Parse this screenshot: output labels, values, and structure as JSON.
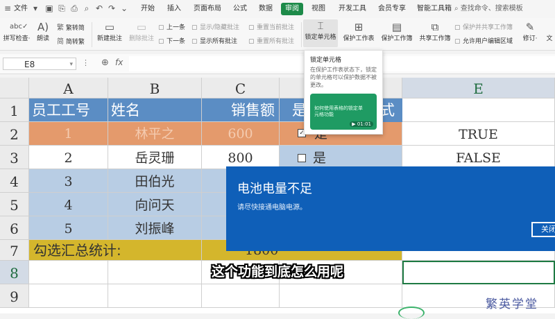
{
  "menubar": {
    "file_label": "文件",
    "tabs": [
      "开始",
      "插入",
      "页面布局",
      "公式",
      "数据",
      "审阅",
      "视图",
      "开发工具",
      "会员专享",
      "智能工具箱"
    ],
    "active_tab": "审阅",
    "search_placeholder": "查找命令、搜索模板"
  },
  "ribbon": {
    "spellcheck": "拼写检查·",
    "read_aloud": "朗读",
    "trad_to_simp": "繁转简",
    "simp_to_trad": "简转繁",
    "new_comment": "新建批注",
    "delete_comment": "删除批注",
    "prev_comment": "上一条",
    "next_comment": "下一条",
    "show_hide_comment": "显示/隐藏批注",
    "show_all_comments": "显示所有批注",
    "reset_current_comment": "重置当前批注",
    "reset_all_comments": "重置所有批注",
    "lock_cell": "锁定单元格",
    "protect_sheet": "保护工作表",
    "protect_workbook": "保护工作簿",
    "share_workbook": "共享工作簿",
    "protect_and_share": "保护并共享工作簿",
    "allow_edit_ranges": "允许用户编辑区域",
    "revise": "修订·",
    "doc": "文"
  },
  "formula_bar": {
    "cell_ref": "E8",
    "fx": "fx"
  },
  "sheet": {
    "columns": [
      "A",
      "B",
      "C",
      "",
      "E"
    ],
    "rows": [
      "1",
      "2",
      "3",
      "4",
      "5",
      "6",
      "7",
      "8",
      "9"
    ],
    "header": {
      "a": "员工工号",
      "b": "姓名",
      "c": "销售额",
      "d": "是",
      "f": "式"
    },
    "data": [
      {
        "a": "1",
        "b": "林平之",
        "c": "600",
        "d": "是",
        "e": "TRUE"
      },
      {
        "a": "2",
        "b": "岳灵珊",
        "c": "800",
        "d": "是",
        "e": "FALSE"
      },
      {
        "a": "3",
        "b": "田伯光"
      },
      {
        "a": "4",
        "b": "向问天"
      },
      {
        "a": "5",
        "b": "刘振峰"
      }
    ],
    "total_label": "勾选汇总统计:",
    "total_value": "1800"
  },
  "tooltip": {
    "title": "锁定单元格",
    "body": "在保护工作表状态下，锁定的单元格可以保护数据不被更改。",
    "video_text": "如何使用表格的锁定单元格功能",
    "video_time": "01:01"
  },
  "notification": {
    "title": "电池电量不足",
    "message": "请尽快接通电脑电源。",
    "close_label": "关闭"
  },
  "subtitle": "这个功能到底怎么用呢",
  "watermark": "繁英学堂",
  "colors": {
    "accent_green": "#1d8a49",
    "header_blue": "#5b8dc4",
    "row_orange": "#e49a6c",
    "row_blue": "#b8cde4",
    "total_yellow": "#d4b62c",
    "toast_blue": "#0f5fb8"
  }
}
